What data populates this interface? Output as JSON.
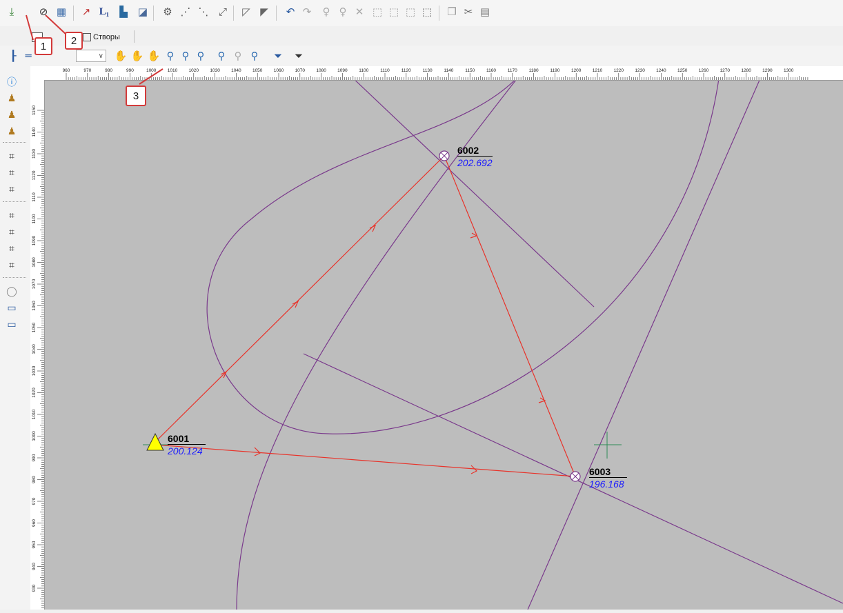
{
  "toolbar_top": {
    "icons": [
      "download-icon",
      "polygon-edit-icon",
      "grid-icon",
      "curve-icon",
      "L1-icon",
      "chart-icon",
      "layers-icon",
      "network-icon",
      "nodes-icon",
      "stations-icon",
      "adjust-icon",
      "triangle-icon",
      "triangle-fill-icon",
      "undo-icon",
      "redo-icon",
      "bulb-icon",
      "bulb-off-icon",
      "close-icon",
      "select-icon",
      "select-add-icon",
      "select-remove-icon",
      "select-all-icon",
      "copy-icon",
      "cut-icon",
      "paste-icon"
    ],
    "l1_label": "L₁"
  },
  "tabs": {
    "alignments_label": "Створы"
  },
  "toolbar_view": {
    "combo_value": "∨"
  },
  "callouts": [
    "1",
    "2",
    "3"
  ],
  "ruler_h": {
    "ticks": [
      "960",
      "970",
      "980",
      "990",
      "1000",
      "1010",
      "1020",
      "1030",
      "1040",
      "1050",
      "1060",
      "1070",
      "1080",
      "1090",
      "1100",
      "1110",
      "1120",
      "1130",
      "1140",
      "1150",
      "1160",
      "1170",
      "1180",
      "1190",
      "1200",
      "1210",
      "1220",
      "1230",
      "1240",
      "1250",
      "1260",
      "1270",
      "1280",
      "1290",
      "1300"
    ]
  },
  "ruler_v": {
    "ticks": [
      "1150",
      "1140",
      "1130",
      "1120",
      "1110",
      "1100",
      "1090",
      "1080",
      "1070",
      "1060",
      "1050",
      "1040",
      "1030",
      "1020",
      "1010",
      "1000",
      "990",
      "980",
      "970",
      "960",
      "950",
      "940",
      "930"
    ]
  },
  "points": [
    {
      "name": "6002",
      "elevation": "202.692"
    },
    {
      "name": "6001",
      "elevation": "200.124"
    },
    {
      "name": "6003",
      "elevation": "196.168"
    }
  ],
  "colors": {
    "canvas_bg": "#bdbdbd",
    "traverse_line": "#e8332a",
    "alignment_line": "#7a3a8c",
    "elevation_text": "#1a1aff",
    "callout_border": "#d33a3a",
    "station_marker": "#ffff00",
    "crosshair": "#2e8b57"
  }
}
